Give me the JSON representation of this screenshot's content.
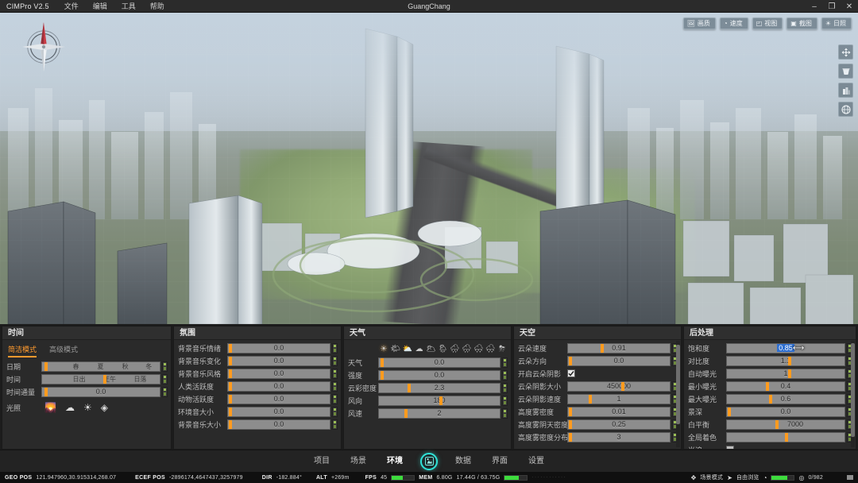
{
  "titlebar": {
    "app_name": "CIMPro V2.5",
    "menus": [
      "文件",
      "编辑",
      "工具",
      "帮助"
    ],
    "document_title": "GuangChang",
    "window_controls": [
      {
        "name": "minimize",
        "glyph": "–"
      },
      {
        "name": "maximize",
        "glyph": "❐"
      },
      {
        "name": "close",
        "glyph": "✕"
      }
    ]
  },
  "viewport": {
    "compass_icon": "compass-rose-icon",
    "toolbar": [
      {
        "label": "画质",
        "icon": "image-quality-icon"
      },
      {
        "label": "速度",
        "icon": "speed-gauge-icon"
      },
      {
        "label": "视图",
        "icon": "view-cube-icon"
      },
      {
        "label": "截图",
        "icon": "screenshot-icon"
      },
      {
        "label": "日照",
        "icon": "sun-icon"
      }
    ],
    "rail": [
      {
        "name": "pan-move-tool",
        "icon": "move-arrows-icon"
      },
      {
        "name": "measure-tool",
        "icon": "bucket-icon"
      },
      {
        "name": "building-tool",
        "icon": "building-icon"
      },
      {
        "name": "globe-tool",
        "icon": "globe-icon"
      }
    ]
  },
  "panels": {
    "time": {
      "title": "时间",
      "tabs": [
        {
          "label": "简洁模式",
          "active": true
        },
        {
          "label": "高级模式",
          "active": false
        }
      ],
      "rows": [
        {
          "label": "日期",
          "value": "",
          "knob_pct": 2,
          "segments": [
            "春",
            "夏",
            "秋",
            "冬"
          ]
        },
        {
          "label": "时间",
          "value": "",
          "knob_pct": 52,
          "segments": [
            "日出",
            "正午",
            "日落"
          ]
        },
        {
          "label": "时间通量",
          "value": "0.0",
          "knob_pct": 2,
          "segments": []
        }
      ],
      "light_label": "光照",
      "light_icons": [
        "sunrise-icon",
        "cloud-icon",
        "sun-icon",
        "layers-icon"
      ]
    },
    "atmosphere": {
      "title": "氛围",
      "rows": [
        {
          "label": "背景音乐情绪",
          "value": "0.0",
          "knob_pct": 1
        },
        {
          "label": "背景音乐变化",
          "value": "0.0",
          "knob_pct": 1
        },
        {
          "label": "背景音乐风格",
          "value": "0.0",
          "knob_pct": 1
        },
        {
          "label": "人类活跃度",
          "value": "0.0",
          "knob_pct": 1
        },
        {
          "label": "动物活跃度",
          "value": "0.0",
          "knob_pct": 1
        },
        {
          "label": "环境音大小",
          "value": "0.0",
          "knob_pct": 1
        },
        {
          "label": "背景音乐大小",
          "value": "0.0",
          "knob_pct": 1
        }
      ]
    },
    "weather": {
      "title": "天气",
      "icon_strip": [
        "sun-icon",
        "sun-cloud-icon",
        "sun-cloud-2-icon",
        "cloud-icon",
        "cloud-dark-icon",
        "rain-light-icon",
        "rain-icon",
        "rain-heavy-icon",
        "snow-light-icon",
        "snow-icon",
        "storm-icon"
      ],
      "selected_icon_index": 0,
      "rows": [
        {
          "label": "天气",
          "value": "0.0",
          "knob_pct": 1
        },
        {
          "label": "强度",
          "value": "0.0",
          "knob_pct": 1
        },
        {
          "label": "云彩密度",
          "value": "2.3",
          "knob_pct": 24
        },
        {
          "label": "风向",
          "value": "180",
          "knob_pct": 50
        },
        {
          "label": "风速",
          "value": "2",
          "knob_pct": 21
        }
      ]
    },
    "sky": {
      "title": "天空",
      "rows": [
        {
          "type": "slider",
          "label": "云朵速度",
          "value": "0.91",
          "knob_pct": 32
        },
        {
          "type": "slider",
          "label": "云朵方向",
          "value": "0.0",
          "knob_pct": 1
        },
        {
          "type": "checkbox",
          "label": "开启云朵阴影",
          "checked": true
        },
        {
          "type": "slider",
          "label": "云朵阴影大小",
          "value": "450000",
          "knob_pct": 52
        },
        {
          "type": "slider",
          "label": "云朵阴影速度",
          "value": "1",
          "knob_pct": 20
        },
        {
          "type": "slider",
          "label": "高度雾密度",
          "value": "0.01",
          "knob_pct": 1
        },
        {
          "type": "slider",
          "label": "高度雾阴天密度",
          "value": "0.25",
          "knob_pct": 1
        },
        {
          "type": "slider",
          "label": "高度雾密度分布",
          "value": "3",
          "knob_pct": 1
        }
      ],
      "scroll_thumb_top_pct": 4,
      "scroll_thumb_height_pct": 74
    },
    "post": {
      "title": "后处理",
      "rows": [
        {
          "type": "slider",
          "label": "饱和度",
          "value": "0.85",
          "knob_pct": 50,
          "editing": true
        },
        {
          "type": "slider",
          "label": "对比度",
          "value": "1.1",
          "knob_pct": 52
        },
        {
          "type": "slider",
          "label": "自动曝光",
          "value": "1",
          "knob_pct": 52
        },
        {
          "type": "slider",
          "label": "最小曝光",
          "value": "0.4",
          "knob_pct": 33
        },
        {
          "type": "slider",
          "label": "最大曝光",
          "value": "0.6",
          "knob_pct": 36
        },
        {
          "type": "slider",
          "label": "景深",
          "value": "0.0",
          "knob_pct": 1
        },
        {
          "type": "slider",
          "label": "白平衡",
          "value": "7000",
          "knob_pct": 41
        },
        {
          "type": "slider",
          "label": "全局着色",
          "value": "",
          "knob_pct": 49
        },
        {
          "type": "checkbox",
          "label": "光追",
          "checked": false
        }
      ],
      "scroll_thumb_top_pct": 2,
      "scroll_thumb_height_pct": 88
    }
  },
  "navbar": {
    "items": [
      {
        "label": "项目",
        "active": false
      },
      {
        "label": "场景",
        "active": false
      },
      {
        "label": "环境",
        "active": true
      }
    ],
    "orb_icon": "scene-orb-icon",
    "items_right": [
      {
        "label": "数据",
        "active": false
      },
      {
        "label": "界面",
        "active": false
      },
      {
        "label": "设置",
        "active": false
      }
    ]
  },
  "statusbar": {
    "geo_pos_key": "GEO POS",
    "geo_pos_value": "121.947960,30.915314,268.07",
    "ecef_pos_key": "ECEF POS",
    "ecef_pos_value": "-2896174,4647437,3257979",
    "dir_key": "DIR",
    "dir_value": "-182.884°",
    "alt_key": "ALT",
    "alt_value": "+269m",
    "fps_key": "FPS",
    "fps_value": "45",
    "fps_meter_pct": 50,
    "mem_key": "MEM",
    "mem_value": "6.80G",
    "mem_total_value": "17.44G / 63.75G",
    "mem_meter_pct": 62,
    "scene_mode_label": "场景模式",
    "nav_mode_label": "自由浏览",
    "load_meter_pct": 70,
    "counter_value": "0/982"
  }
}
